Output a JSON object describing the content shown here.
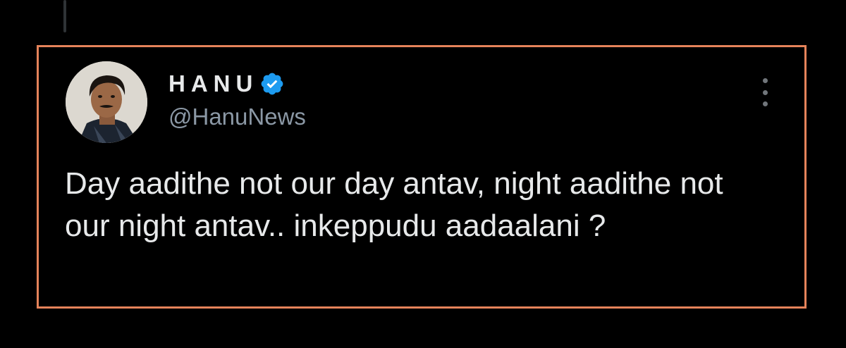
{
  "tweet": {
    "author": {
      "display_name": "HANU",
      "handle": "@HanuNews",
      "verified": true
    },
    "text": "Day aadithe not our day antav, night aadithe not our night antav.. inkeppudu aadaalani ?",
    "more_icon": "more-vertical-icon"
  },
  "colors": {
    "background": "#000000",
    "highlight_border": "#e5835a",
    "verified_blue": "#1d9bf0",
    "text_primary": "#e7e9ea",
    "text_secondary": "#8b98a5"
  }
}
